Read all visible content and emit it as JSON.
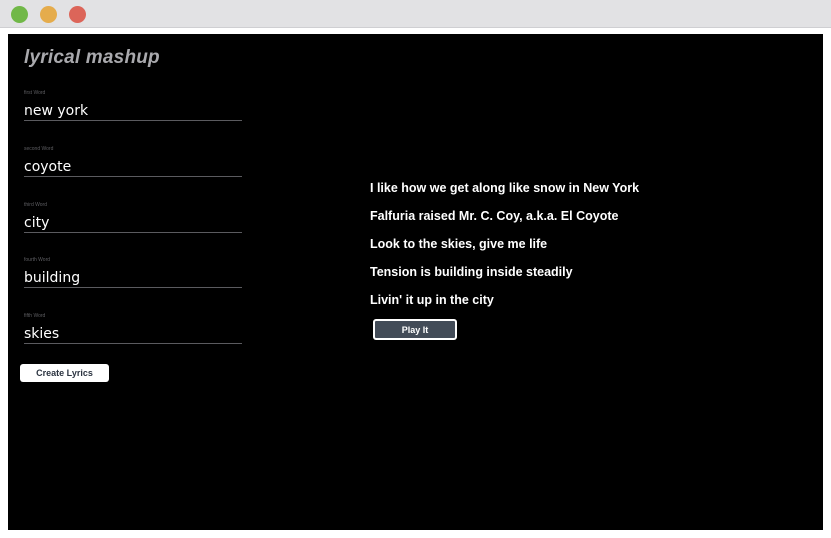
{
  "window": {
    "controls": [
      "green",
      "yellow",
      "red"
    ]
  },
  "app": {
    "title": "lyrical mashup"
  },
  "form": {
    "fields": [
      {
        "label": "first Word",
        "value": "new york"
      },
      {
        "label": "second Word",
        "value": "coyote"
      },
      {
        "label": "third Word",
        "value": "city"
      },
      {
        "label": "fourth Word",
        "value": "building"
      },
      {
        "label": "fifth Word",
        "value": "skies"
      }
    ],
    "create_label": "Create Lyrics"
  },
  "lyrics": {
    "lines": [
      "I like how we get along like snow in New York",
      "Falfuria raised Mr. C. Coy, a.k.a. El Coyote",
      "Look to the skies, give me life",
      "Tension is building inside steadily",
      "Livin' it up in the city"
    ],
    "play_label": "Play It"
  },
  "colors": {
    "background": "#000000",
    "title": "#a9a9ad",
    "text": "#ffffff",
    "play_button": "#434c58",
    "create_button_text": "#2b3340"
  }
}
